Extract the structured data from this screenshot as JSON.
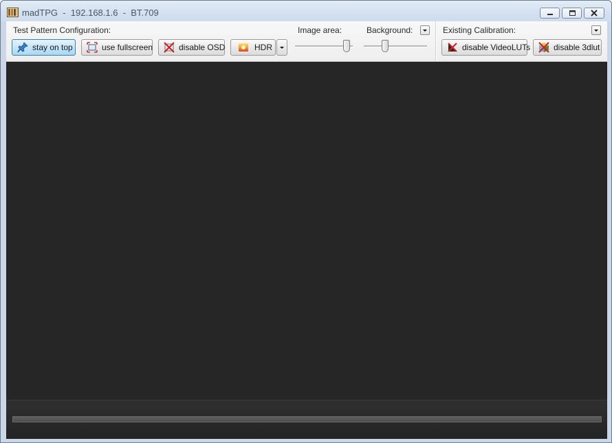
{
  "window": {
    "title": "madTPG  -  192.168.1.6  -  BT.709",
    "icons": {
      "app": "madtpg-app-icon",
      "minimize": "minimize-icon",
      "maximize": "maximize-icon",
      "close": "close-icon"
    }
  },
  "toolbar": {
    "test_pattern_label": "Test Pattern Configuration:",
    "buttons": {
      "stay_on_top": {
        "label": "stay on top",
        "icon": "pin-icon",
        "active": true
      },
      "use_fullscreen": {
        "label": "use fullscreen",
        "icon": "fullscreen-icon",
        "active": false
      },
      "disable_osd": {
        "label": "disable OSD",
        "icon": "osd-disabled-icon",
        "active": false
      },
      "hdr": {
        "label": "HDR",
        "icon": "hdr-icon",
        "active": false
      }
    },
    "image_area_label": "Image area:",
    "background_label": "Background:",
    "image_area_level": 0.95,
    "background_level": 0.32,
    "existing_calibration_label": "Existing Calibration:",
    "calibration_buttons": {
      "disable_videoluts": {
        "label": "disable VideoLUTs",
        "icon": "videoluts-disabled-icon"
      },
      "disable_3dlut": {
        "label": "disable 3dlut",
        "icon": "3dlut-disabled-icon"
      }
    }
  },
  "pattern": {
    "background_color": "#262626"
  },
  "progress": {
    "value": 0.0
  },
  "colors": {
    "title_bar": "#d3e0ef",
    "active_button": "#c4e5f8",
    "pattern_background": "#262626"
  }
}
